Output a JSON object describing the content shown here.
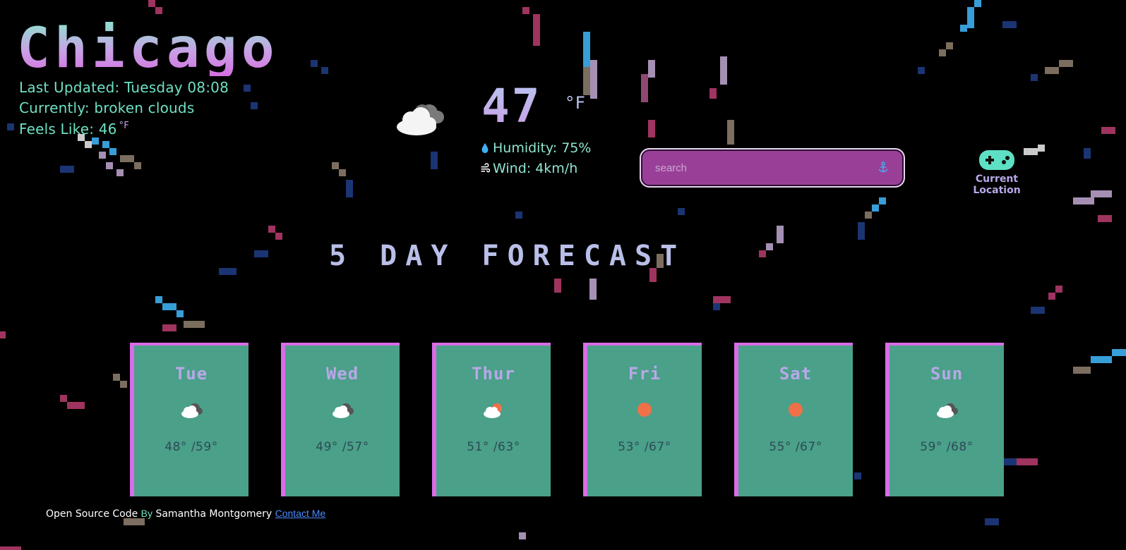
{
  "header": {
    "city": "Chicago",
    "last_updated": "Last Updated: Tuesday 08:08",
    "currently": "Currently: broken clouds",
    "feels_like": "Feels Like: 46",
    "feels_like_unit": "°F"
  },
  "current": {
    "icon": "broken-clouds-icon",
    "temperature": "47",
    "unit": "°F",
    "humidity": "Humidity: 75%",
    "wind": "Wind: 4km/h"
  },
  "search": {
    "placeholder": "search",
    "value": "",
    "button_icon": "anchor-search-icon"
  },
  "location": {
    "label": "Current Location",
    "icon": "gamepad-icon"
  },
  "forecast": {
    "title": "5 DAY FORECAST",
    "days": [
      {
        "day": "Tue",
        "icon": "broken-clouds-icon",
        "range": "48° /59°"
      },
      {
        "day": "Wed",
        "icon": "broken-clouds-icon",
        "range": "49° /57°"
      },
      {
        "day": "Thur",
        "icon": "few-clouds-icon",
        "range": "51° /63°"
      },
      {
        "day": "Fri",
        "icon": "sun-icon",
        "range": "53° /67°"
      },
      {
        "day": "Sat",
        "icon": "sun-icon",
        "range": "55° /67°"
      },
      {
        "day": "Sun",
        "icon": "broken-clouds-icon",
        "range": "59° /68°"
      }
    ]
  },
  "footer": {
    "open_source": "Open Source Code",
    "by": "By",
    "author": "Samantha Montgomery",
    "contact": "Contact Me"
  },
  "colors": {
    "accent_teal": "#6fe0c4",
    "accent_pink": "#d86de6",
    "card_bg": "#4aa088",
    "search_bg": "#9a3f98",
    "sun": "#f07048"
  }
}
